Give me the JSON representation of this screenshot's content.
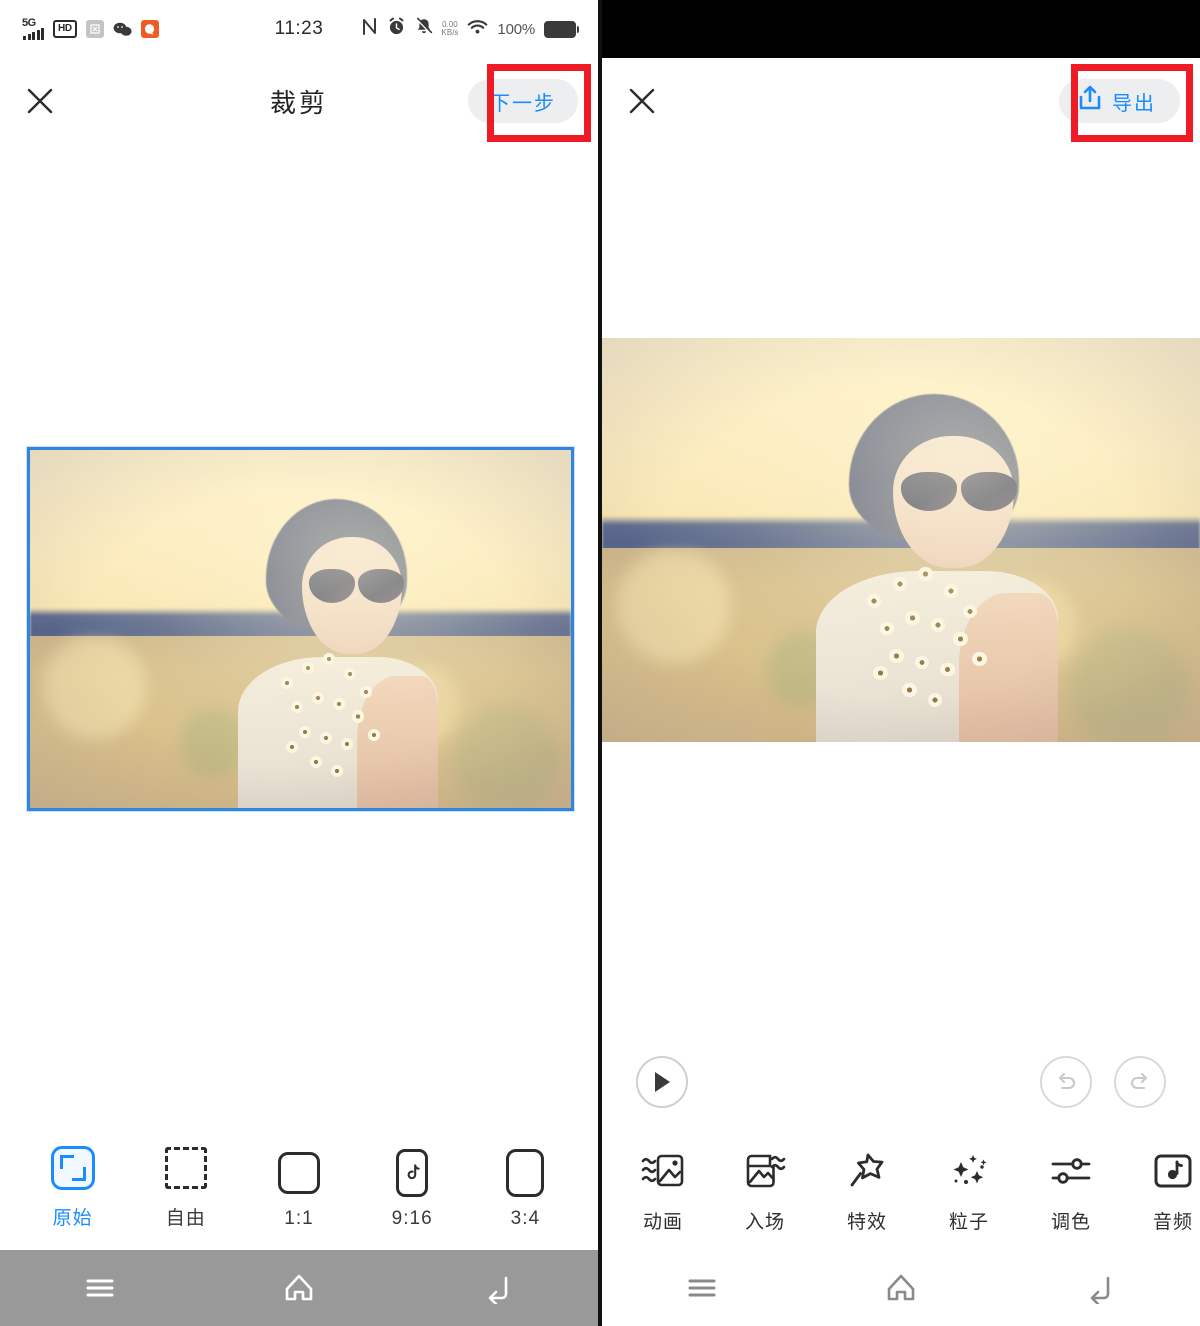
{
  "left_screen": {
    "status_bar": {
      "network_label": "5G",
      "hd_badge": "HD",
      "app_icons": [
        "screenshot-icon",
        "wechat-icon",
        "qq-browser-icon"
      ],
      "time": "11:23",
      "nfc_icon": "nfc-icon",
      "alarm_icon": "alarm-icon",
      "mute_icon": "bell-muted-icon",
      "data_rate_value": "0.00",
      "data_rate_unit": "KB/s",
      "wifi_icon": "wifi-icon",
      "battery_percent": "100%",
      "battery_icon": "battery-full-icon"
    },
    "header": {
      "close_icon": "close-icon",
      "title": "裁剪",
      "next_button_label": "下一步"
    },
    "ratio_options": [
      {
        "label": "原始",
        "icon": "original-frame-icon",
        "active": true
      },
      {
        "label": "自由",
        "icon": "free-crop-icon",
        "active": false
      },
      {
        "label": "1:1",
        "icon": "square-ratio-icon",
        "active": false
      },
      {
        "label": "9:16",
        "icon": "tiktok-ratio-icon",
        "active": false
      },
      {
        "label": "3:4",
        "icon": "portrait-ratio-icon",
        "active": false
      }
    ],
    "nav_bar": {
      "menu_icon": "menu-icon",
      "home_icon": "home-icon",
      "back_icon": "back-icon"
    }
  },
  "right_screen": {
    "header": {
      "close_icon": "close-icon",
      "export_icon": "share-export-icon",
      "export_label": "导出"
    },
    "playback": {
      "play_icon": "play-icon",
      "undo_icon": "undo-icon",
      "redo_icon": "redo-icon"
    },
    "tools": [
      {
        "label": "动画",
        "icon": "animation-icon"
      },
      {
        "label": "入场",
        "icon": "entrance-icon"
      },
      {
        "label": "特效",
        "icon": "magic-effects-icon"
      },
      {
        "label": "粒子",
        "icon": "particles-icon"
      },
      {
        "label": "调色",
        "icon": "color-adjust-icon"
      },
      {
        "label": "音频",
        "icon": "audio-icon"
      }
    ],
    "nav_bar": {
      "menu_icon": "menu-icon",
      "home_icon": "home-icon",
      "back_icon": "back-icon"
    }
  },
  "annotations": {
    "highlight_color": "#ee1b24",
    "accent_color": "#1a8cff",
    "crop_frame_color": "#2f86e0",
    "nav_bar_gray": "#999999"
  }
}
